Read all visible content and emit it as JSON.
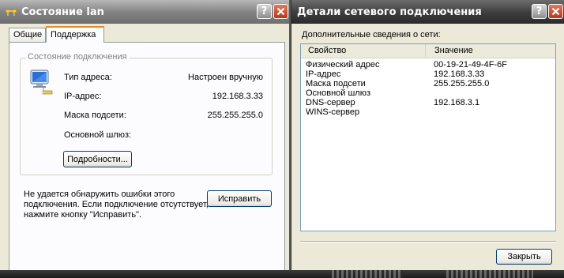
{
  "status_window": {
    "title": "Состояние lan",
    "tabs": [
      {
        "label": "Общие"
      },
      {
        "label": "Поддержка"
      }
    ],
    "group_title": "Состояние подключения",
    "rows": [
      {
        "label": "Тип адреса:",
        "value": "Настроен вручную"
      },
      {
        "label": "IP-адрес:",
        "value": "192.168.3.33"
      },
      {
        "label": "Маска подсети:",
        "value": "255.255.255.0"
      },
      {
        "label": "Основной шлюз:",
        "value": ""
      }
    ],
    "details_button": "Подробности...",
    "repair_note": "Не удается обнаружить ошибки этого подключения. Если подключение отсутствует, нажмите кнопку \"Исправить\".",
    "repair_button": "Исправить"
  },
  "details_window": {
    "title": "Детали сетевого подключения",
    "subtitle": "Дополнительные сведения о сети:",
    "columns": {
      "property": "Свойство",
      "value": "Значение"
    },
    "rows": [
      {
        "property": "Физический адрес",
        "value": "00-19-21-49-4F-6F"
      },
      {
        "property": "IP-адрес",
        "value": "192.168.3.33"
      },
      {
        "property": "Маска подсети",
        "value": "255.255.255.0"
      },
      {
        "property": "Основной шлюз",
        "value": ""
      },
      {
        "property": "DNS-сервер",
        "value": "192.168.3.1"
      },
      {
        "property": "WINS-сервер",
        "value": ""
      }
    ],
    "close_button": "Закрыть"
  },
  "icons": [
    "lan-icon",
    "network-adapter-icon",
    "help-icon",
    "close-icon"
  ],
  "colors": {
    "active_tab_accent": "#e68b2c",
    "close_button": "#c9502e",
    "dialog_background": "#ece9d8"
  }
}
